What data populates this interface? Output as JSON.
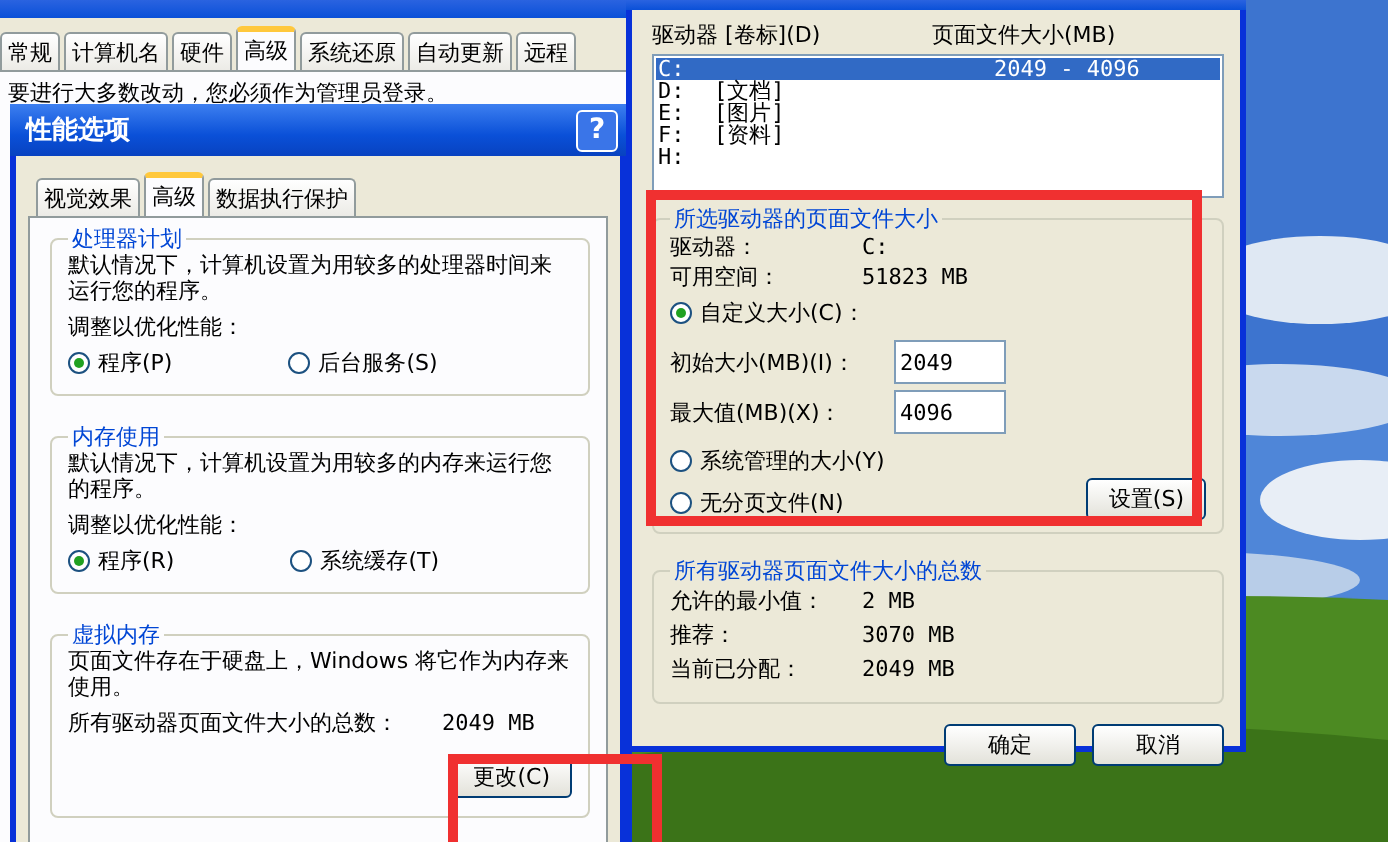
{
  "system_properties": {
    "tabs": [
      {
        "label": "常规",
        "selected": false
      },
      {
        "label": "计算机名",
        "selected": false
      },
      {
        "label": "硬件",
        "selected": false
      },
      {
        "label": "高级",
        "selected": true
      },
      {
        "label": "系统还原",
        "selected": false
      },
      {
        "label": "自动更新",
        "selected": false
      },
      {
        "label": "远程",
        "selected": false
      }
    ],
    "notice": "要进行大多数改动，您必须作为管理员登录。"
  },
  "performance_options": {
    "title": "性能选项",
    "help_button": "?",
    "tabs": [
      {
        "label": "视觉效果",
        "selected": false
      },
      {
        "label": "高级",
        "selected": true
      },
      {
        "label": "数据执行保护",
        "selected": false
      }
    ],
    "groups": [
      {
        "title": "处理器计划",
        "description": "默认情况下，计算机设置为用较多的处理器时间来运行您的程序。",
        "prompt": "调整以优化性能：",
        "options": [
          {
            "label": "程序(P)",
            "selected": true
          },
          {
            "label": "后台服务(S)",
            "selected": false
          }
        ]
      },
      {
        "title": "内存使用",
        "description": "默认情况下，计算机设置为用较多的内存来运行您的程序。",
        "prompt": "调整以优化性能：",
        "options": [
          {
            "label": "程序(R)",
            "selected": true
          },
          {
            "label": "系统缓存(T)",
            "selected": false
          }
        ]
      }
    ],
    "virtual_memory": {
      "title": "虚拟内存",
      "description": "页面文件存在于硬盘上，Windows 将它作为内存来使用。",
      "total_label": "所有驱动器页面文件大小的总数：",
      "total_value": "2049 MB",
      "button": "更改(C)"
    }
  },
  "virtual_memory_dialog": {
    "columns": [
      "驱动器 [卷标](D)",
      "页面文件大小(MB)"
    ],
    "drives": [
      {
        "drive": "C:",
        "size": "2049 - 4096",
        "selected": true
      },
      {
        "drive": "D:",
        "volume": "[文档]",
        "selected": false
      },
      {
        "drive": "E:",
        "volume": "[图片]",
        "selected": false
      },
      {
        "drive": "F:",
        "volume": "[资料]",
        "selected": false
      },
      {
        "drive": "H:",
        "selected": false
      }
    ],
    "selected_drive": {
      "title": "所选驱动器的页面文件大小",
      "fields": [
        {
          "label": "驱动器：",
          "value": "C:"
        },
        {
          "label": "可用空间：",
          "value": "51823 MB"
        }
      ],
      "size_options": [
        {
          "label": "自定义大小(C)：",
          "selected": true
        },
        {
          "label": "系统管理的大小(Y)",
          "selected": false
        },
        {
          "label": "无分页文件(N)",
          "selected": false
        }
      ],
      "inputs": [
        {
          "label": "初始大小(MB)(I)：",
          "value": "2049"
        },
        {
          "label": "最大值(MB)(X)：",
          "value": "4096"
        }
      ],
      "button": "设置(S)"
    },
    "totals": {
      "title": "所有驱动器页面文件大小的总数",
      "rows": [
        {
          "label": "允许的最小值：",
          "value": "2 MB"
        },
        {
          "label": "推荐：",
          "value": "3070 MB"
        },
        {
          "label": "当前已分配：",
          "value": "2049 MB"
        }
      ]
    },
    "buttons": [
      "确定",
      "取消"
    ]
  }
}
